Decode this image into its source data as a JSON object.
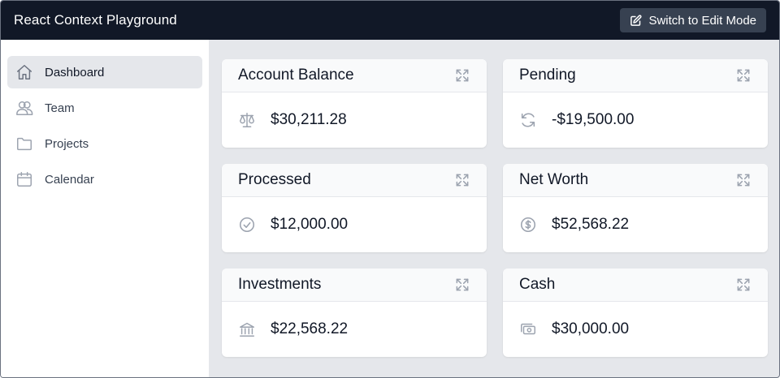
{
  "header": {
    "title": "React Context Playground",
    "edit_button": "Switch to Edit Mode",
    "edit_icon": "edit-icon"
  },
  "sidebar": {
    "items": [
      {
        "label": "Dashboard",
        "icon": "home-icon",
        "active": true
      },
      {
        "label": "Team",
        "icon": "users-icon",
        "active": false
      },
      {
        "label": "Projects",
        "icon": "folder-icon",
        "active": false
      },
      {
        "label": "Calendar",
        "icon": "calendar-icon",
        "active": false
      }
    ]
  },
  "cards": [
    {
      "title": "Account Balance",
      "value": "$30,211.28",
      "icon": "scale-icon"
    },
    {
      "title": "Pending",
      "value": "-$19,500.00",
      "icon": "refresh-icon"
    },
    {
      "title": "Processed",
      "value": "$12,000.00",
      "icon": "check-circle-icon"
    },
    {
      "title": "Net Worth",
      "value": "$52,568.22",
      "icon": "dollar-circle-icon"
    },
    {
      "title": "Investments",
      "value": "$22,568.22",
      "icon": "bank-icon"
    },
    {
      "title": "Cash",
      "value": "$30,000.00",
      "icon": "cash-icon"
    }
  ],
  "colors": {
    "topbar": "#111827",
    "button": "#374151",
    "active_nav": "#e5e7eb",
    "icon_gray": "#9ca3af"
  }
}
